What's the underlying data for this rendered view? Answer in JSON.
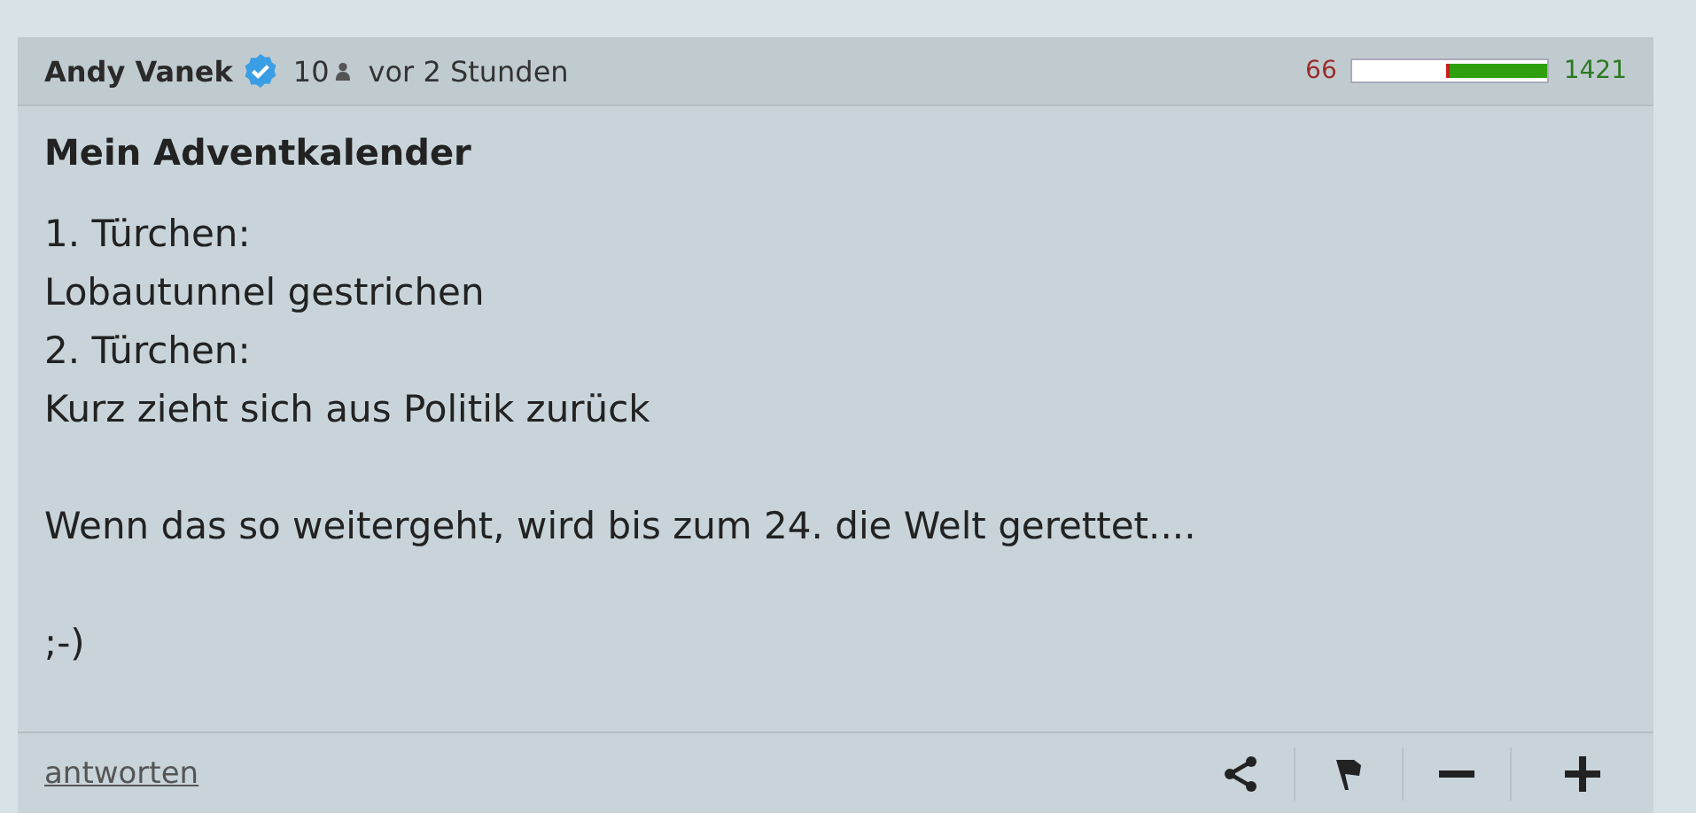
{
  "post": {
    "author": "Andy Vanek",
    "verified": true,
    "followers": "10",
    "time": "vor 2 Stunden",
    "votes": {
      "negative": {
        "count": "66",
        "level": 0.05
      },
      "positive": {
        "count": "1421",
        "level": 1
      }
    },
    "title": "Mein Adventkalender",
    "paragraphs": [
      "1. Türchen:\nLobautunnel gestrichen\n2. Türchen:\nKurz zieht sich aus Politik zurück",
      "Wenn das so weitergeht, wird bis zum 24. die Welt gerettet....",
      ";-)"
    ],
    "reply_link": "antworten",
    "actions": [
      {
        "kind": "share"
      },
      {
        "kind": "flag"
      },
      {
        "kind": "minus"
      },
      {
        "kind": "plus"
      }
    ]
  }
}
